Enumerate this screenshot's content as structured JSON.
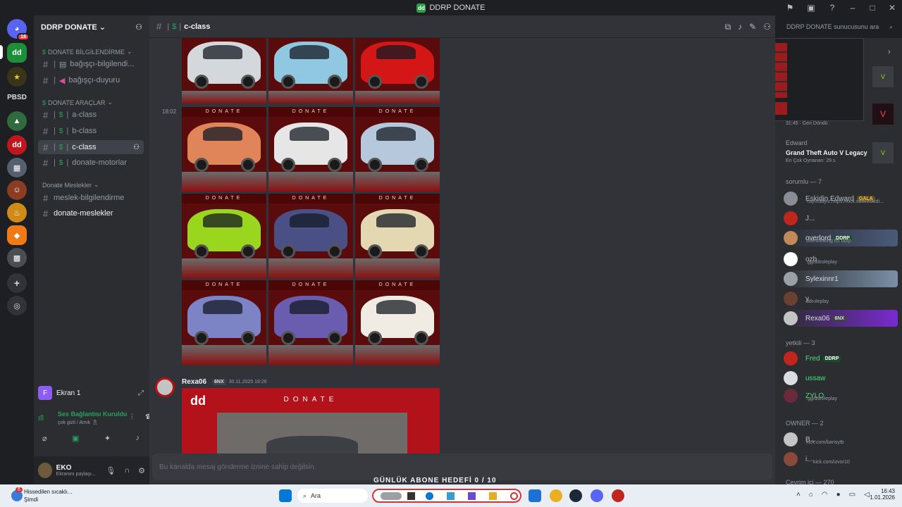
{
  "window": {
    "title": "DDRP DONATE"
  },
  "rail": {
    "badge": "18",
    "text_server": "PBSD"
  },
  "guild": {
    "name": "DDRP DONATE"
  },
  "sidebar": {
    "cat1": "DONATE BİLGİLENDİRME",
    "ch_bagisci_bilgi": "bağışçı-bilgilendi...",
    "ch_bagisci_duyuru": "bağışçı-duyuru",
    "cat2": "DONATE ARAÇLAR",
    "ch_a": "a-class",
    "ch_b": "b-class",
    "ch_c": "c-class",
    "ch_motor": "donate-motorlar",
    "cat3": "Donate Meslekler",
    "ch_meslek_bilgi": "meslek-bilgilendirme",
    "ch_donate_meslek": "donate-meslekler"
  },
  "screen_share": {
    "title": "Ekran 1",
    "voice_status": "Ses Bağlantısı Kuruldu",
    "voice_channel": "çok gizli / Amık 🎗"
  },
  "user": {
    "name": "EKO",
    "status": "Ekranını paylaşı..."
  },
  "header": {
    "channel": "c-class",
    "search_placeholder": "DDRP DONATE sunucusunu ara"
  },
  "messages": {
    "time1": "18:02",
    "tile_label": "DONATE",
    "author": "Rexa06",
    "author_tag": "6NX",
    "timestamp": "30.11.2025 19:26",
    "embed_label": "DONATE",
    "composer": "Bu kanalda mesaj gönderme iznine sahip değilsin.",
    "overlay": "GÜNLÜK ABONE HEDEFİ   0 / 10"
  },
  "activity": {
    "small_time": "31:45",
    "small_label": "Geri Döndü",
    "user": "Edward",
    "game": "Grand Theft Auto V Legacy",
    "game_sub": "En Çok Oynanan: 29 s"
  },
  "members": {
    "cat_sorumlu": "sorumlu — 7",
    "cat_yetkili": "yetkili — 3",
    "cat_owner": "OWNER — 2",
    "cat_online": "Çevrim içi — 270",
    "list": [
      {
        "name": "Eskidin Edward",
        "tag": "GALA",
        "sub": "Yayındayız:https://kick.com/eskidi..."
      },
      {
        "name": "J...",
        "tag": "",
        "sub": ""
      },
      {
        "name": "overlord",
        "tag": "DDRP",
        "sub": "overthinking for ddrp"
      },
      {
        "name": "ozb",
        "tag": "",
        "sub": ".gg/ddroleplay"
      },
      {
        "name": "Sylexinnr1",
        "tag": "",
        "sub": ""
      },
      {
        "name": "y",
        "tag": "",
        "sub": "ddroleplay"
      },
      {
        "name": "Rexa06",
        "tag": "6NX",
        "sub": ""
      },
      {
        "name": "Fred",
        "tag": "DDRP",
        "sub": ""
      },
      {
        "name": "ussaw",
        "tag": "",
        "sub": ""
      },
      {
        "name": "ZYLO",
        "tag": "",
        "sub": ".gg/ddroleplay"
      },
      {
        "name": "B...",
        "tag": "",
        "sub": "kick.com/barisytb"
      },
      {
        "name": "i...",
        "tag": "",
        "sub": "kick.com/izvor10"
      }
    ]
  },
  "taskbar": {
    "notif_badge": "6",
    "notif_title": "Hissedilen sıcaklı...",
    "notif_sub": "Şimdi",
    "search": "Ara",
    "time": "16:43",
    "date": "1.01.2026"
  },
  "colors": {
    "accent_green": "#23a55a",
    "discord_bg": "#313338",
    "brand_red": "#b3121a"
  }
}
